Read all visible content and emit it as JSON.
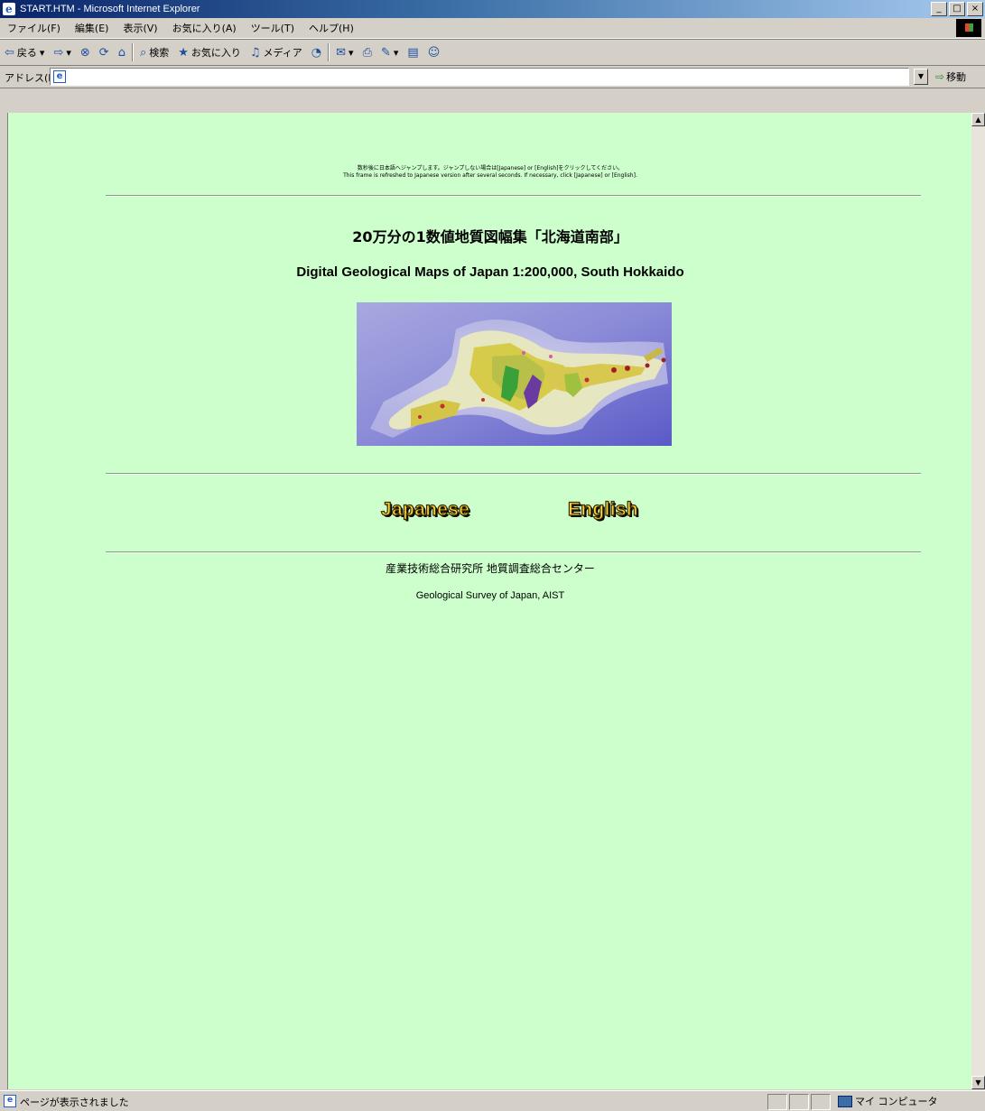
{
  "window": {
    "title": "START.HTM - Microsoft Internet Explorer",
    "buttons": [
      "_",
      "□",
      "×"
    ]
  },
  "menubar": {
    "items": [
      "ファイル(F)",
      "編集(E)",
      "表示(V)",
      "お気に入り(A)",
      "ツール(T)",
      "ヘルプ(H)"
    ]
  },
  "toolbar": {
    "back_label": "戻る",
    "search_label": "検索",
    "favorites_label": "お気に入り",
    "media_label": "メディア"
  },
  "addressbar": {
    "label": "アドレス(D)",
    "value": "",
    "go_label": "移動"
  },
  "page": {
    "notice_ja": "数秒後に日本語へジャンプします。ジャンプしない場合は[Japanese] or [English]をクリックしてください。",
    "notice_en": "This frame is refreshed to Japanese version after several seconds. If necessary, click [Japanese] or [English].",
    "title_ja": "20万分の1数値地質図幅集「北海道南部」",
    "title_en": "Digital Geological Maps of Japan 1:200,000, South Hokkaido",
    "japanese_link": "Japanese",
    "english_link": "English",
    "footer_ja": "産業技術総合研究所 地質調査総合センター",
    "footer_en": "Geological Survey of Japan, AIST"
  },
  "statusbar": {
    "text": "ページが表示されました",
    "zone": "マイ コンピュータ"
  },
  "colors": {
    "page_background": "#ccffcc",
    "link_text": "#ffd83a"
  }
}
